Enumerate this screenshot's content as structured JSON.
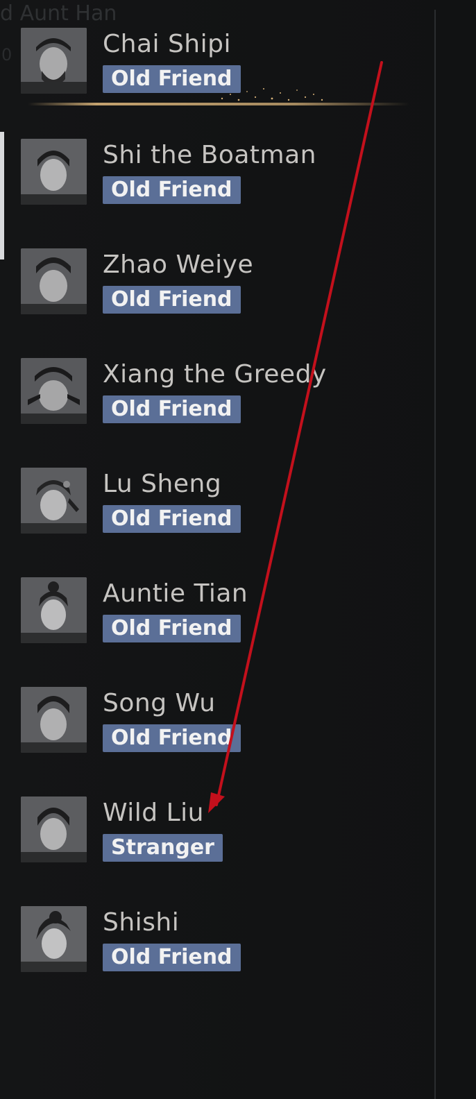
{
  "header": {
    "ghost_title": "d Aunt Han",
    "ghost_fragment": "0"
  },
  "contacts": [
    {
      "name": "Chai Shipi",
      "relation": "Old Friend",
      "selected": true
    },
    {
      "name": "Shi the Boatman",
      "relation": "Old Friend",
      "selected": false
    },
    {
      "name": "Zhao Weiye",
      "relation": "Old Friend",
      "selected": false
    },
    {
      "name": "Xiang the Greedy",
      "relation": "Old Friend",
      "selected": false
    },
    {
      "name": "Lu Sheng",
      "relation": "Old Friend",
      "selected": false
    },
    {
      "name": "Auntie Tian",
      "relation": "Old Friend",
      "selected": false
    },
    {
      "name": "Song Wu",
      "relation": "Old Friend",
      "selected": false
    },
    {
      "name": "Wild Liu",
      "relation": "Stranger",
      "selected": false
    },
    {
      "name": "Shishi",
      "relation": "Old Friend",
      "selected": false
    }
  ],
  "colors": {
    "badge": "#5b6f97",
    "name_text": "#c6c4c1",
    "selection_line": "#d6b178",
    "annotation_arrow": "#c3101c"
  }
}
